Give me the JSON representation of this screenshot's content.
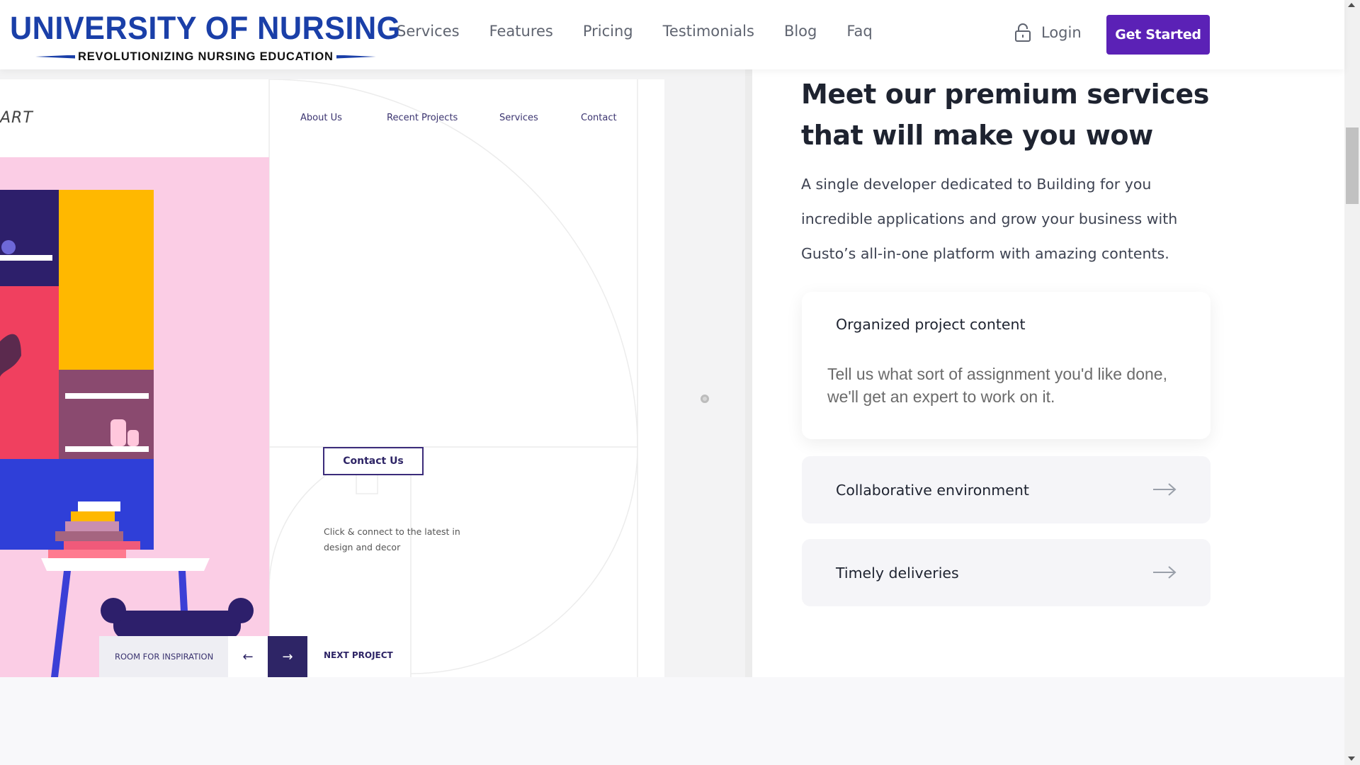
{
  "header": {
    "logo_title": "UNIVERSITY OF NURSING",
    "logo_subtitle": "REVOLUTIONIZING NURSING EDUCATION",
    "nav": [
      "Services",
      "Features",
      "Pricing",
      "Testimonials",
      "Blog",
      "Faq"
    ],
    "login_label": "Login",
    "login_icon": "lock-icon",
    "cta_label": "Get Started"
  },
  "preview": {
    "brand": "ART",
    "nav": [
      "About Us",
      "Recent Projects",
      "Services",
      "Contact"
    ],
    "contact_button": "Contact Us",
    "contact_text": "Click & connect to the latest in design and decor",
    "room_label": "ROOM FOR INSPIRATION",
    "next_label": "NEXT PROJECT"
  },
  "services": {
    "title": "Meet our premium services that will make you wow",
    "description": "A single developer dedicated to Building for you incredible applications and grow your business with Gusto’s all-in-one platform with amazing contents.",
    "cards": [
      {
        "title": "Organized project content",
        "body": "Tell us what sort of assignment you'd like done, we'll get an expert to work on it.",
        "expanded": true
      },
      {
        "title": "Collaborative environment",
        "expanded": false
      },
      {
        "title": "Timely deliveries",
        "expanded": false
      }
    ]
  },
  "colors": {
    "brand_blue": "#1a3fa8",
    "cta_purple": "#5b21b6",
    "preview_pink": "#fbcde5",
    "preview_navy": "#2e2566"
  }
}
